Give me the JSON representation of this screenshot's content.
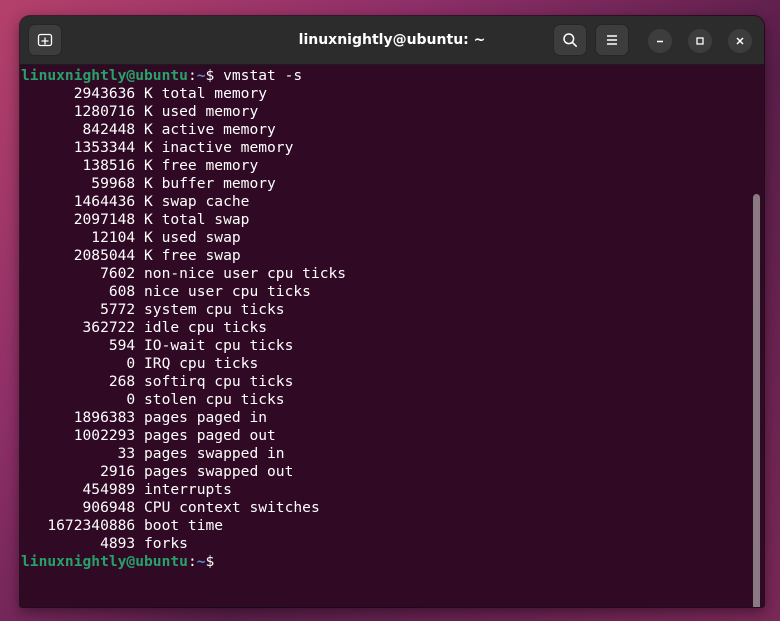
{
  "window": {
    "title": "linuxnightly@ubuntu: ~"
  },
  "icons": {
    "new_tab": "new-tab-icon",
    "search": "search-icon",
    "menu": "hamburger-menu-icon",
    "minimize": "minimize-icon",
    "maximize": "maximize-icon",
    "close": "close-icon"
  },
  "colors": {
    "terminal_bg": "#300a24",
    "prompt_user": "#26a269",
    "prompt_path": "#5b8fd6",
    "text": "#ffffff"
  },
  "prompt": {
    "user_host": "linuxnightly@ubuntu",
    "colon": ":",
    "path": "~",
    "symbol": "$ "
  },
  "command": "vmstat -s",
  "output": [
    "      2943636 K total memory",
    "      1280716 K used memory",
    "       842448 K active memory",
    "      1353344 K inactive memory",
    "       138516 K free memory",
    "        59968 K buffer memory",
    "      1464436 K swap cache",
    "      2097148 K total swap",
    "        12104 K used swap",
    "      2085044 K free swap",
    "         7602 non-nice user cpu ticks",
    "          608 nice user cpu ticks",
    "         5772 system cpu ticks",
    "       362722 idle cpu ticks",
    "          594 IO-wait cpu ticks",
    "            0 IRQ cpu ticks",
    "          268 softirq cpu ticks",
    "            0 stolen cpu ticks",
    "      1896383 pages paged in",
    "      1002293 pages paged out",
    "           33 pages swapped in",
    "         2916 pages swapped out",
    "       454989 interrupts",
    "       906948 CPU context switches",
    "   1672340886 boot time",
    "         4893 forks"
  ]
}
